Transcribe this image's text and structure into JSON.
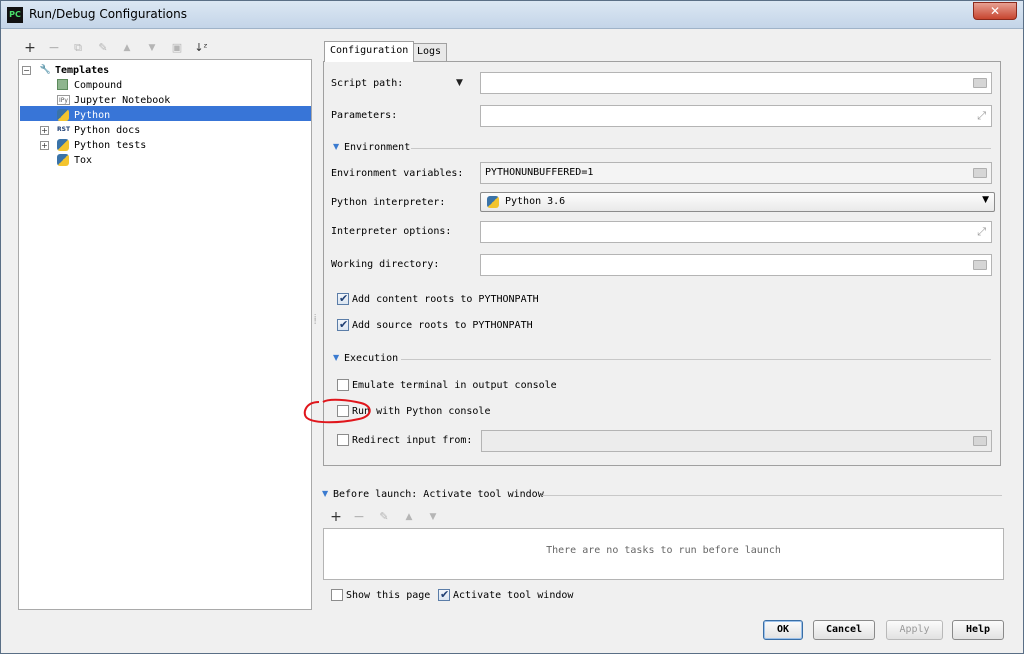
{
  "window": {
    "title": "Run/Debug Configurations",
    "app_icon_text": "PC",
    "close_glyph": "✕"
  },
  "toolbar": {
    "buttons": [
      {
        "icon": "plus-icon",
        "glyph": "+"
      },
      {
        "icon": "minus-icon",
        "glyph": "−"
      },
      {
        "icon": "copy-icon",
        "glyph": "⧉"
      },
      {
        "icon": "wrench-icon",
        "glyph": "🔧"
      },
      {
        "icon": "arrow-up-icon",
        "glyph": "▲"
      },
      {
        "icon": "arrow-down-icon",
        "glyph": "▼"
      },
      {
        "icon": "folder-icon",
        "glyph": "▣"
      },
      {
        "icon": "sort-icon",
        "glyph": "↓"
      }
    ]
  },
  "tree": {
    "root": {
      "label": "Templates",
      "icon": "wrench-icon"
    },
    "items": [
      {
        "label": "Compound",
        "icon": "compound-icon"
      },
      {
        "label": "Jupyter Notebook",
        "icon": "jupyter-icon"
      },
      {
        "label": "Python",
        "icon": "python-icon",
        "selected": true
      },
      {
        "label": "Python docs",
        "icon": "rst-icon",
        "expandable": true
      },
      {
        "label": "Python tests",
        "icon": "python-tests-icon",
        "expandable": true
      },
      {
        "label": "Tox",
        "icon": "tox-icon"
      }
    ],
    "rst_badge": "RST",
    "ipy_badge": "IPy"
  },
  "tabs": [
    {
      "label": "Configuration",
      "active": true
    },
    {
      "label": "Logs",
      "active": false
    }
  ],
  "config": {
    "script_path_label": "Script path:",
    "script_path_value": "",
    "parameters_label": "Parameters:",
    "parameters_value": "",
    "environment_section": "Environment",
    "env_vars_label": "Environment variables:",
    "env_vars_value": "PYTHONUNBUFFERED=1",
    "interpreter_label": "Python interpreter:",
    "interpreter_value": "Python 3.6",
    "interp_options_label": "Interpreter options:",
    "interp_options_value": "",
    "working_dir_label": "Working directory:",
    "working_dir_value": "",
    "add_content_roots": {
      "label": "Add content roots to PYTHONPATH",
      "checked": true
    },
    "add_source_roots": {
      "label": "Add source roots to PYTHONPATH",
      "checked": true
    },
    "execution_section": "Execution",
    "emulate_terminal": {
      "label": "Emulate terminal in output console",
      "checked": false
    },
    "run_with_console": {
      "label": "Run with Python console",
      "checked": false
    },
    "redirect_input": {
      "label": "Redirect input from:",
      "checked": false
    },
    "redirect_value": ""
  },
  "before_launch": {
    "title": "Before launch: Activate tool window",
    "empty_text": "There are no tasks to run before launch",
    "toolbar": [
      "plus-icon",
      "minus-icon",
      "pencil-icon",
      "arrow-up-icon",
      "arrow-down-icon"
    ]
  },
  "footer": {
    "show_this_page": {
      "label": "Show this page",
      "checked": false
    },
    "activate_tool_window": {
      "label": "Activate tool window",
      "checked": true
    },
    "ok": "OK",
    "cancel": "Cancel",
    "apply": "Apply",
    "help": "Help"
  },
  "colors": {
    "selection": "#3875d7",
    "annotation": "#e0161c",
    "section_triangle": "#3b7bd0"
  }
}
